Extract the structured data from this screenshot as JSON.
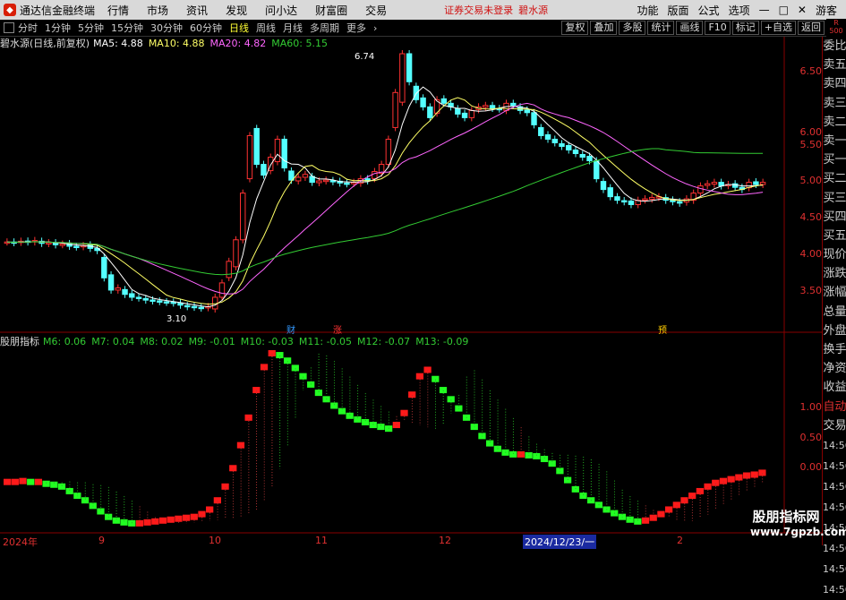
{
  "app": {
    "title": "通达信金融终端",
    "logo": "tdx-logo-icon"
  },
  "menu": [
    "行情",
    "市场",
    "资讯",
    "发现",
    "问小达",
    "财富圈",
    "交易"
  ],
  "status": {
    "login": "证券交易未登录",
    "stock": "碧水源"
  },
  "right_menu": [
    "功能",
    "版面",
    "公式",
    "选项"
  ],
  "user": "游客",
  "periods": [
    "分时",
    "1分钟",
    "5分钟",
    "15分钟",
    "30分钟",
    "60分钟",
    "日线",
    "周线",
    "月线",
    "多周期",
    "更多"
  ],
  "active_period": "日线",
  "right_tools": [
    "复权",
    "叠加",
    "多股",
    "统计",
    "画线",
    "F10",
    "标记",
    "+自选",
    "返回"
  ],
  "r_badge": {
    "line1": "R",
    "line2": "500"
  },
  "main_legend": {
    "title": "碧水源(日线,前复权)",
    "ma5": "MA5: 4.88",
    "ma10": "MA10: 4.88",
    "ma20": "MA20: 4.82",
    "ma60": "MA60: 5.15"
  },
  "ind_legend": {
    "title": "股朋指标",
    "items": [
      "M6: 0.06",
      "M7: 0.04",
      "M8: 0.02",
      "M9: -0.01",
      "M10: -0.03",
      "M11: -0.05",
      "M12: -0.07",
      "M13: -0.09"
    ]
  },
  "price_axis": [
    "6.50",
    "6.00",
    "5.50",
    "5.00",
    "4.50",
    "4.00",
    "3.50"
  ],
  "ind_axis": [
    "1.00",
    "0.50",
    "0.00"
  ],
  "annotations": {
    "high": "6.74",
    "low": "3.10"
  },
  "markers": [
    "财",
    "涨",
    "预"
  ],
  "time_axis": [
    "2024年",
    "9",
    "10",
    "11",
    "12",
    "2"
  ],
  "selected_date": "2024/12/23/一",
  "side_items": [
    "委比",
    "卖五",
    "卖四",
    "卖三",
    "卖二",
    "卖一",
    "买一",
    "买二",
    "买三",
    "买四",
    "买五",
    "现价",
    "涨跌",
    "涨幅",
    "总量",
    "外盘",
    "换手",
    "净资",
    "收益",
    "自动",
    "交易"
  ],
  "side_times": [
    "14:56",
    "14:56",
    "14:56",
    "14:56",
    "14:56",
    "14:56",
    "14:56",
    "14:56"
  ],
  "watermark": {
    "line1": "股朋指标网",
    "line2": "www.7gpzb.com"
  },
  "colors": {
    "up": "#ff3232",
    "down": "#54ffff",
    "ma5": "#ffffff",
    "ma10": "#ffff66",
    "ma20": "#ff66ff",
    "ma60": "#33cc33",
    "ind_up": "#ff1a1a",
    "ind_down": "#22ff22",
    "axis": "#e03030"
  },
  "chart_data": [
    {
      "type": "candlestick",
      "y_range": [
        3.1,
        6.74
      ],
      "closes": [
        4.12,
        4.11,
        4.13,
        4.12,
        4.14,
        4.1,
        4.11,
        4.08,
        4.09,
        4.06,
        4.05,
        4.07,
        4.03,
        4.0,
        3.62,
        3.45,
        3.48,
        3.39,
        3.35,
        3.34,
        3.31,
        3.3,
        3.29,
        3.28,
        3.27,
        3.24,
        3.22,
        3.21,
        3.2,
        3.22,
        3.35,
        3.55,
        3.85,
        4.15,
        4.8,
        5.6,
        5.2,
        5.05,
        5.3,
        5.55,
        5.15,
        4.98,
        5.02,
        5.06,
        4.95,
        4.97,
        4.98,
        4.96,
        4.94,
        4.93,
        4.95,
        5.0,
        4.97,
        5.1,
        5.2,
        5.55,
        6.2,
        6.74,
        6.35,
        6.1,
        6.0,
        5.85,
        6.1,
        6.05,
        6.0,
        5.9,
        5.85,
        5.95,
        6.0,
        6.02,
        5.98,
        5.97,
        6.05,
        6.02,
        5.95,
        5.92,
        5.75,
        5.6,
        5.55,
        5.5,
        5.45,
        5.4,
        5.35,
        5.3,
        5.25,
        5.0,
        4.85,
        4.75,
        4.7,
        4.68,
        4.64,
        4.7,
        4.72,
        4.74,
        4.75,
        4.7,
        4.68,
        4.66,
        4.72,
        4.8,
        4.9,
        4.93,
        4.95,
        4.9,
        4.92,
        4.88,
        4.85,
        4.95,
        4.92,
        4.95
      ]
    },
    {
      "type": "bar",
      "y_range": [
        -0.5,
        1.4
      ],
      "values": [
        0.0,
        0.0,
        0.01,
        0.0,
        0.0,
        -0.02,
        -0.03,
        -0.05,
        -0.1,
        -0.15,
        -0.2,
        -0.26,
        -0.32,
        -0.38,
        -0.42,
        -0.44,
        -0.45,
        -0.45,
        -0.44,
        -0.43,
        -0.42,
        -0.41,
        -0.4,
        -0.39,
        -0.38,
        -0.35,
        -0.3,
        -0.2,
        -0.05,
        0.15,
        0.4,
        0.7,
        1.0,
        1.25,
        1.4,
        1.38,
        1.32,
        1.24,
        1.15,
        1.06,
        0.97,
        0.9,
        0.83,
        0.77,
        0.72,
        0.68,
        0.65,
        0.62,
        0.6,
        0.58,
        0.62,
        0.75,
        0.95,
        1.15,
        1.22,
        1.12,
        1.0,
        0.9,
        0.8,
        0.7,
        0.6,
        0.5,
        0.42,
        0.36,
        0.32,
        0.3,
        0.3,
        0.29,
        0.28,
        0.25,
        0.2,
        0.12,
        0.02,
        -0.08,
        -0.15,
        -0.2,
        -0.25,
        -0.3,
        -0.34,
        -0.38,
        -0.41,
        -0.43,
        -0.42,
        -0.39,
        -0.35,
        -0.3,
        -0.25,
        -0.2,
        -0.15,
        -0.1,
        -0.05,
        -0.01,
        0.01,
        0.03,
        0.05,
        0.07,
        0.08,
        0.1
      ]
    }
  ]
}
